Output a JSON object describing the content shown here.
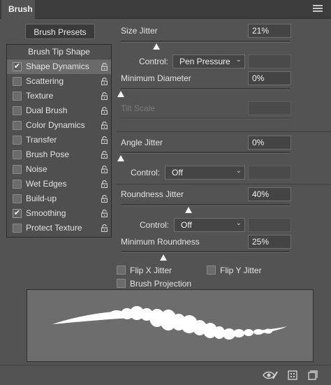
{
  "panel": {
    "tab_label": "Brush"
  },
  "left": {
    "presets_button": "Brush Presets",
    "header": "Brush Tip Shape",
    "options": [
      {
        "label": "Shape Dynamics",
        "checked": true,
        "selected": true
      },
      {
        "label": "Scattering",
        "checked": false
      },
      {
        "label": "Texture",
        "checked": false
      },
      {
        "label": "Dual Brush",
        "checked": false
      },
      {
        "label": "Color Dynamics",
        "checked": false
      },
      {
        "label": "Transfer",
        "checked": false
      },
      {
        "label": "Brush Pose",
        "checked": false
      },
      {
        "label": "Noise",
        "checked": false
      },
      {
        "label": "Wet Edges",
        "checked": false
      },
      {
        "label": "Build-up",
        "checked": false
      },
      {
        "label": "Smoothing",
        "checked": true
      },
      {
        "label": "Protect Texture",
        "checked": false
      }
    ]
  },
  "right": {
    "size_jitter": {
      "label": "Size Jitter",
      "value": "21%",
      "fraction": 0.21
    },
    "size_control": {
      "label": "Control:",
      "value": "Pen Pressure"
    },
    "min_diameter": {
      "label": "Minimum Diameter",
      "value": "0%",
      "fraction": 0.0
    },
    "tilt_scale": {
      "label": "Tilt Scale"
    },
    "angle_jitter": {
      "label": "Angle Jitter",
      "value": "0%",
      "fraction": 0.0
    },
    "angle_control": {
      "label": "Control:",
      "value": "Off"
    },
    "roundness_jitter": {
      "label": "Roundness Jitter",
      "value": "40%",
      "fraction": 0.4
    },
    "roundness_control": {
      "label": "Control:",
      "value": "Off"
    },
    "min_roundness": {
      "label": "Minimum Roundness",
      "value": "25%",
      "fraction": 0.25
    },
    "flip_x": {
      "label": "Flip X Jitter",
      "checked": false
    },
    "flip_y": {
      "label": "Flip Y Jitter",
      "checked": false
    },
    "brush_projection": {
      "label": "Brush Projection",
      "checked": false
    }
  },
  "colors": {
    "panel_bg": "#535353",
    "preview_bg": "#6d6d6d",
    "stroke": "#ffffff"
  },
  "icons": [
    "panel-menu-icon",
    "lock-icon",
    "chevron-down-icon",
    "eye-brush-icon",
    "brush-settings-icon",
    "new-brush-icon"
  ]
}
